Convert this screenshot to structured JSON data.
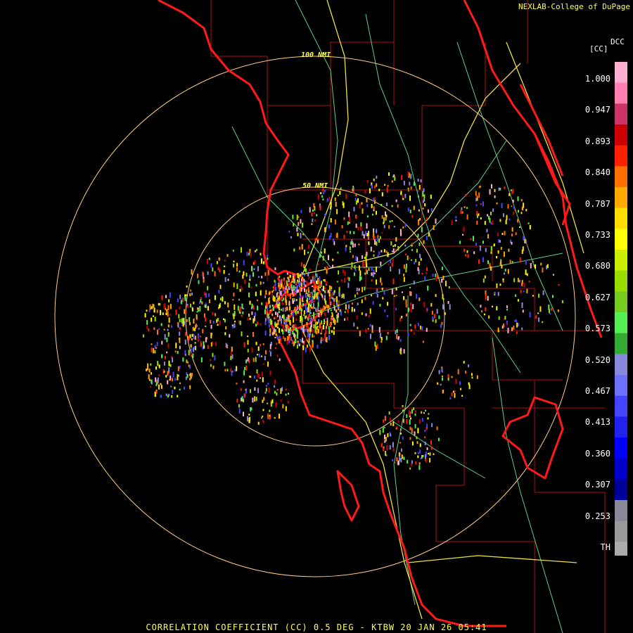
{
  "header": {
    "credit": "NEXLAB-College of DuPage",
    "product_code": "DCC",
    "unit_label": "[CC]"
  },
  "legend": {
    "ticks": [
      "1.000",
      "0.947",
      "0.893",
      "0.840",
      "0.787",
      "0.733",
      "0.680",
      "0.627",
      "0.573",
      "0.520",
      "0.467",
      "0.413",
      "0.360",
      "0.307",
      "0.253",
      "TH"
    ],
    "colors": [
      "#ffb0d0",
      "#ff80b0",
      "#cc3366",
      "#cc0000",
      "#ff2000",
      "#ff7000",
      "#ffaa00",
      "#ffdd00",
      "#ffff00",
      "#ccee00",
      "#99dd00",
      "#77cc22",
      "#55ee55",
      "#33aa33",
      "#8888dd",
      "#7070ff",
      "#4444ff",
      "#2222ee",
      "#0000ff",
      "#0000cc",
      "#000099",
      "#888899",
      "#999999",
      "#aaaaaa"
    ]
  },
  "rings": {
    "inner_label": "50 NMI",
    "outer_label": "100 NMI"
  },
  "footer": {
    "text": "CORRELATION COEFFICIENT (CC) 0.5 DEG - KTBW 20 JAN 26 05:41"
  },
  "colors": {
    "coast": "#ff1a1a",
    "county": "#b01010",
    "roads": "#5fd08a",
    "interstate": "#f0e040",
    "rings": "#ffcc88"
  }
}
